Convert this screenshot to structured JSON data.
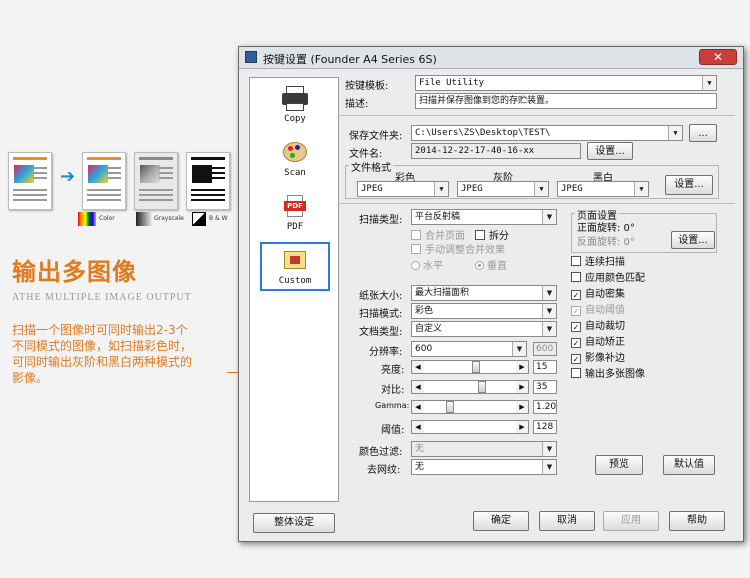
{
  "marketing": {
    "title": "输出多图像",
    "subtitle": "ATHE MULTIPLE IMAGE OUTPUT",
    "description": [
      "扫描一个图像时可同时输出2-3个",
      "不同模式的图像，如扫描彩色时，",
      "可同时输出灰阶和黑白两种模式的",
      "影像。"
    ],
    "swatch_labels": [
      "Color",
      "Grayscale",
      "B & W"
    ],
    "accent": "#e07a1f"
  },
  "window": {
    "title": "按键设置 (Founder A4 Series 6S)",
    "close_glyph": "✕"
  },
  "tools": [
    {
      "label": "Copy",
      "icon": "printer-icon"
    },
    {
      "label": "Scan",
      "icon": "palette-icon"
    },
    {
      "label": "PDF",
      "icon": "pdf-icon"
    },
    {
      "label": "Custom",
      "icon": "custom-icon",
      "selected": true
    }
  ],
  "form": {
    "template_label": "按键模板:",
    "template_value": "File Utility",
    "desc_label": "描述:",
    "desc_value": "扫描并保存图像到您的存贮装置。",
    "folder_label": "保存文件夹:",
    "folder_value": "C:\\Users\\ZS\\Desktop\\TEST\\",
    "browse_label": "...",
    "filename_label": "文件名:",
    "filename_value": "2014-12-22-17-40-16-xx",
    "filename_btn": "设置...",
    "format_group": "文件格式",
    "format_cols": [
      "彩色",
      "灰阶",
      "黑白"
    ],
    "format_values": [
      "JPEG",
      "JPEG",
      "JPEG"
    ],
    "format_btn": "设置...",
    "scan_type_label": "扫描类型:",
    "scan_type_value": "平台反射稿",
    "merge_pages": "合并页面",
    "split": "拆分",
    "manual_adjust": "手动调整合并效果",
    "horizontal": "水平",
    "vertical": "垂直",
    "page_group": "页面设置",
    "front_rotate": "正面旋转: 0°",
    "back_rotate": "反面旋转: 0°",
    "page_btn": "设置...",
    "paper_label": "纸张大小:",
    "paper_value": "最大扫描面积",
    "mode_label": "扫描模式:",
    "mode_value": "彩色",
    "doc_label": "文档类型:",
    "doc_value": "自定义",
    "dpi_label": "分辨率:",
    "dpi_value": "600",
    "dpi_readonly": "600",
    "brightness_label": "亮度:",
    "brightness_value": "15",
    "contrast_label": "对比:",
    "contrast_value": "35",
    "gamma_label": "Gamma:",
    "gamma_value": "1.20",
    "threshold_label": "阈值:",
    "threshold_value": "128",
    "dropout_label": "颜色过滤:",
    "dropout_value": "无",
    "descreen_label": "去网纹:",
    "descreen_value": "无",
    "checks": [
      {
        "label": "连续扫描",
        "checked": false,
        "disabled": false
      },
      {
        "label": "应用颜色匹配",
        "checked": false,
        "disabled": false
      },
      {
        "label": "自动密集",
        "checked": true,
        "disabled": false
      },
      {
        "label": "自动阈值",
        "checked": true,
        "disabled": true
      },
      {
        "label": "自动裁切",
        "checked": true,
        "disabled": false
      },
      {
        "label": "自动矫正",
        "checked": true,
        "disabled": false
      },
      {
        "label": "影像补边",
        "checked": true,
        "disabled": false
      },
      {
        "label": "输出多张图像",
        "checked": false,
        "disabled": false
      }
    ],
    "preview_btn": "预览",
    "default_btn": "默认值"
  },
  "footer": {
    "global_btn": "整体设定",
    "ok_btn": "确定",
    "cancel_btn": "取消",
    "apply_btn": "应用",
    "help_btn": "帮助"
  }
}
